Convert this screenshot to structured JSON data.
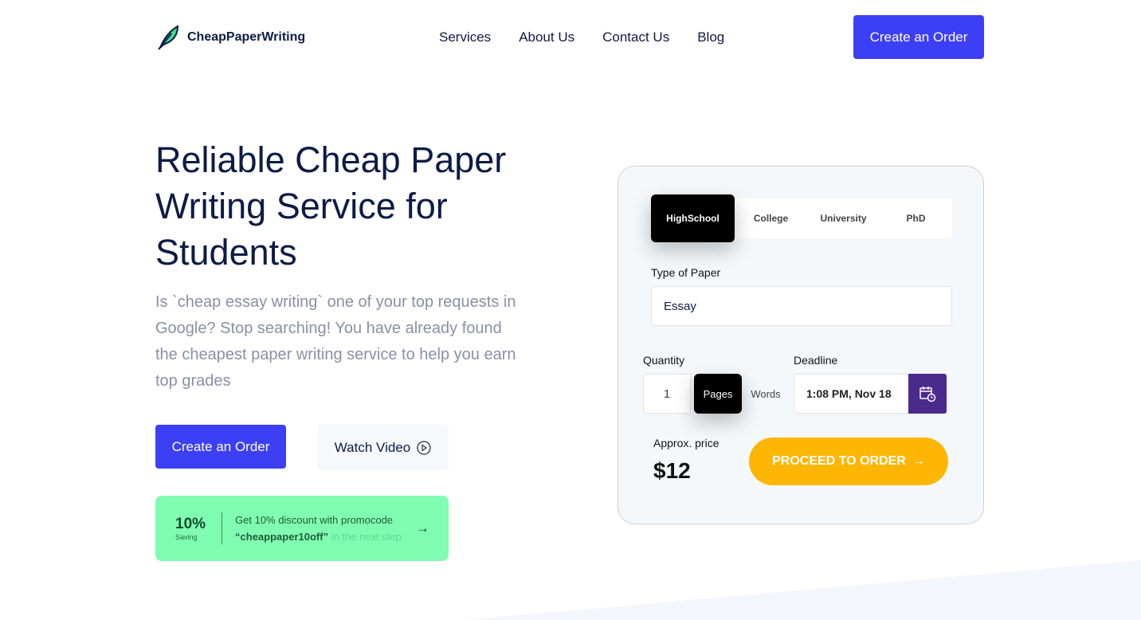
{
  "brand": {
    "name": "CheapPaperWriting",
    "accent": "#3d3ff5"
  },
  "nav": {
    "items": [
      "Services",
      "About Us",
      "Contact Us",
      "Blog"
    ],
    "cta": "Create an Order"
  },
  "hero": {
    "title": "Reliable Cheap Paper Writing Service for Students",
    "lead": "Is `cheap essay writing` one of your top requests in Google? Stop searching! You have already found the cheapest paper writing service to help you earn top grades",
    "cta": "Create an Order",
    "watch": "Watch Video"
  },
  "promo": {
    "percent": "10%",
    "saving": "Saving",
    "line1": "Get 10% discount with promocode",
    "code": "“cheappaper10off”",
    "suffix": "in the next step",
    "color": "#80fcb2"
  },
  "form": {
    "levels": [
      "HighSchool",
      "College",
      "University",
      "PhD"
    ],
    "selected_level": "HighSchool",
    "type_label": "Type of Paper",
    "type_value": "Essay",
    "quantity_label": "Quantity",
    "quantity_value": "1",
    "units": [
      "Pages",
      "Words"
    ],
    "selected_unit": "Pages",
    "deadline_label": "Deadline",
    "deadline_value": "1:08 PM, Nov 18",
    "price_label": "Approx. price",
    "price": "$12",
    "proceed": "PROCEED TO ORDER",
    "proceed_color": "#fdb604"
  }
}
